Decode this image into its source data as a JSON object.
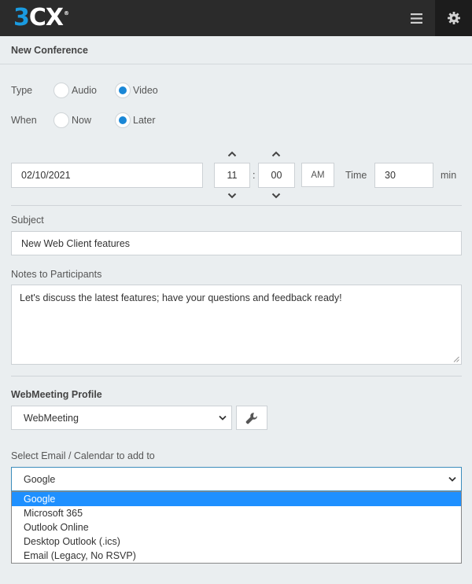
{
  "header": {
    "logo_three": "3",
    "logo_cx": "CX",
    "logo_mark": "®",
    "menu_icon": "hamburger-icon",
    "settings_icon": "gear-icon"
  },
  "page": {
    "title": "New Conference"
  },
  "type": {
    "label": "Type",
    "options": [
      "Audio",
      "Video"
    ],
    "selected": "Video"
  },
  "when": {
    "label": "When",
    "options": [
      "Now",
      "Later"
    ],
    "selected": "Later"
  },
  "schedule": {
    "date": "02/10/2021",
    "hour": "11",
    "separator": ":",
    "minute": "00",
    "ampm": "AM",
    "time_label": "Time",
    "duration": "30",
    "duration_unit": "min"
  },
  "subject": {
    "label": "Subject",
    "value": "New Web Client features"
  },
  "notes": {
    "label": "Notes to Participants",
    "value": "Let's discuss the latest features; have your questions and feedback ready!"
  },
  "profile": {
    "label": "WebMeeting Profile",
    "selected": "WebMeeting",
    "tool_icon": "wrench-icon"
  },
  "calendar": {
    "label": "Select Email / Calendar to add to",
    "selected": "Google",
    "options": [
      "Google",
      "Microsoft 365",
      "Outlook Online",
      "Desktop Outlook (.ics)",
      "Email (Legacy, No RSVP)"
    ]
  },
  "colors": {
    "accent": "#1a87d6",
    "topbar": "#2b2b2b",
    "logo_blue": "#1a9be0",
    "highlight": "#1e90ff"
  }
}
